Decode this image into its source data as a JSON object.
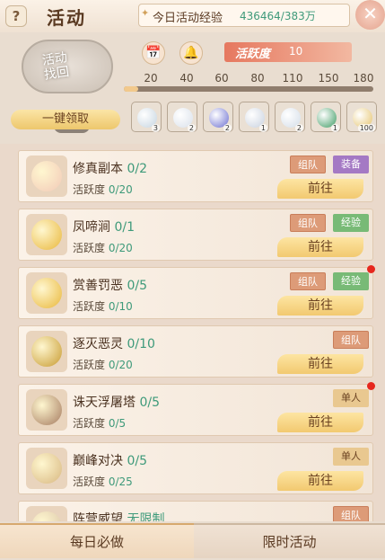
{
  "header": {
    "help": "?",
    "title": "活动",
    "exp_label": "今日活动经验",
    "exp_value": "436464/383万",
    "close": "✕"
  },
  "badge": {
    "text": "活动\n找回"
  },
  "activity": {
    "label": "活跃度",
    "value": "10",
    "ticks": [
      "20",
      "40",
      "60",
      "80",
      "110",
      "150",
      "180"
    ],
    "progress": 0.056
  },
  "claim_all": "一键领取",
  "rewards": [
    {
      "color": "#c5d4e0",
      "count": "3"
    },
    {
      "color": "#d9e0ea",
      "count": "2"
    },
    {
      "color": "#6b6fd1",
      "count": "2"
    },
    {
      "color": "#c8d1df",
      "count": "1"
    },
    {
      "color": "#d3dde8",
      "count": "2"
    },
    {
      "color": "#3c9a62",
      "count": "1"
    },
    {
      "color": "#e5c36b",
      "count": "100"
    }
  ],
  "rows": [
    {
      "name": "修真副本",
      "count": "0/2",
      "active_label": "活跃度",
      "active": "0/20",
      "tags": [
        "组队",
        "装备"
      ],
      "go": "前往",
      "icon": "#f2c9b7",
      "dot": false
    },
    {
      "name": "凤啼涧",
      "count": "0/1",
      "active_label": "活跃度",
      "active": "0/20",
      "tags": [
        "组队",
        "经验"
      ],
      "go": "前往",
      "icon": "#e9b73a",
      "dot": false
    },
    {
      "name": "赏善罚恶",
      "count": "0/5",
      "active_label": "活跃度",
      "active": "0/10",
      "tags": [
        "组队",
        "经验"
      ],
      "go": "前往",
      "icon": "#e9b73a",
      "dot": true
    },
    {
      "name": "逐灭恶灵",
      "count": "0/10",
      "active_label": "活跃度",
      "active": "0/20",
      "tags": [
        "组队"
      ],
      "go": "前往",
      "icon": "#c79a2f",
      "dot": false
    },
    {
      "name": "诛天浮屠塔",
      "count": "0/5",
      "active_label": "活跃度",
      "active": "0/5",
      "tags": [
        "单人"
      ],
      "go": "前往",
      "icon": "#a57a5f",
      "dot": true
    },
    {
      "name": "巅峰对决",
      "count": "0/5",
      "active_label": "活跃度",
      "active": "0/25",
      "tags": [
        "单人"
      ],
      "go": "前往",
      "icon": "#d8b780",
      "dot": false
    },
    {
      "name": "阵营威望",
      "count": "无限制",
      "active_label": "",
      "active": "",
      "tags": [
        "组队"
      ],
      "go": "",
      "icon": "#d9c3a6",
      "dot": false
    }
  ],
  "tabs": {
    "daily": "每日必做",
    "limited": "限时活动"
  }
}
